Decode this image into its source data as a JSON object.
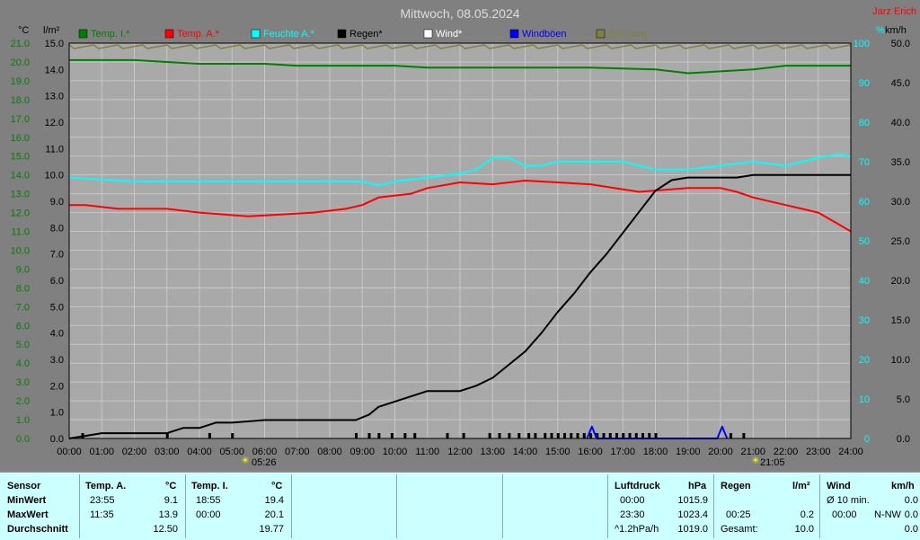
{
  "header": {
    "title": "Mittwoch, 08.05.2024",
    "brand": "Jarz Erich",
    "unit_temp": "°C",
    "unit_rain": "l/m²",
    "unit_pct": "%",
    "unit_wind": "km/h"
  },
  "legend": [
    {
      "label": "Temp. I.*",
      "color": "#008000"
    },
    {
      "label": "Temp. A.*",
      "color": "#ff0000"
    },
    {
      "label": "Feuchte A.*",
      "color": "#00ffff"
    },
    {
      "label": "Regen*",
      "color": "#000000"
    },
    {
      "label": "Wind*",
      "color": "#ffffff"
    },
    {
      "label": "Windböen",
      "color": "#0000ff"
    },
    {
      "label": "Erholung",
      "color": "#808040"
    }
  ],
  "colors": {
    "temp_scale": "#008000",
    "rain_scale": "#000000",
    "humidity_scale": "#00ffff",
    "wind_scale": "#000000",
    "plot_bg": "#a9a9a9",
    "title": "#dcdcdc",
    "brand": "#ff0000"
  },
  "sun": {
    "sunrise": "05:26",
    "sunset": "21:05"
  },
  "chart_data": {
    "type": "line",
    "title": "Mittwoch, 08.05.2024",
    "x_ticks": [
      "00:00",
      "01:00",
      "02:00",
      "03:00",
      "04:00",
      "05:00",
      "06:00",
      "07:00",
      "08:00",
      "09:00",
      "10:00",
      "11:00",
      "12:00",
      "13:00",
      "14:00",
      "15:00",
      "16:00",
      "17:00",
      "18:00",
      "19:00",
      "20:00",
      "21:00",
      "22:00",
      "23:00",
      "24:00"
    ],
    "xlim_hours": [
      0,
      24
    ],
    "axes": {
      "temp": {
        "unit": "°C",
        "range": [
          0,
          21
        ],
        "ticks": [
          "0.0",
          "1.0",
          "2.0",
          "3.0",
          "4.0",
          "5.0",
          "6.0",
          "7.0",
          "8.0",
          "9.0",
          "10.0",
          "11.0",
          "12.0",
          "13.0",
          "14.0",
          "15.0",
          "16.0",
          "17.0",
          "18.0",
          "19.0",
          "20.0",
          "21.0"
        ]
      },
      "rain": {
        "unit": "l/m²",
        "range": [
          0,
          15
        ],
        "ticks": [
          "0.0",
          "1.0",
          "2.0",
          "3.0",
          "4.0",
          "5.0",
          "6.0",
          "7.0",
          "8.0",
          "9.0",
          "10.0",
          "11.0",
          "12.0",
          "13.0",
          "14.0",
          "15.0"
        ]
      },
      "humidity": {
        "unit": "%",
        "range": [
          0,
          100
        ],
        "ticks": [
          "0",
          "10",
          "20",
          "30",
          "40",
          "50",
          "60",
          "70",
          "80",
          "90",
          "100"
        ]
      },
      "wind": {
        "unit": "km/h",
        "range": [
          0,
          50
        ],
        "ticks": [
          "0.0",
          "5.0",
          "10.0",
          "15.0",
          "20.0",
          "25.0",
          "30.0",
          "35.0",
          "40.0",
          "45.0",
          "50.0"
        ]
      }
    },
    "series": [
      {
        "name": "Temp. I.*",
        "axis": "temp",
        "color": "#008000",
        "points": [
          [
            0,
            20.1
          ],
          [
            2,
            20.1
          ],
          [
            3,
            20.0
          ],
          [
            4,
            19.9
          ],
          [
            6,
            19.9
          ],
          [
            7,
            19.8
          ],
          [
            10,
            19.8
          ],
          [
            11,
            19.7
          ],
          [
            16,
            19.7
          ],
          [
            18,
            19.6
          ],
          [
            19,
            19.4
          ],
          [
            20,
            19.5
          ],
          [
            21,
            19.6
          ],
          [
            22,
            19.8
          ],
          [
            24,
            19.8
          ]
        ]
      },
      {
        "name": "Temp. A.*",
        "axis": "temp",
        "color": "#ff0000",
        "points": [
          [
            0,
            12.4
          ],
          [
            0.5,
            12.4
          ],
          [
            1.5,
            12.2
          ],
          [
            3,
            12.2
          ],
          [
            4,
            12.0
          ],
          [
            5.5,
            11.8
          ],
          [
            6.5,
            11.9
          ],
          [
            7.5,
            12.0
          ],
          [
            8.5,
            12.2
          ],
          [
            9,
            12.4
          ],
          [
            9.5,
            12.8
          ],
          [
            10.5,
            13.0
          ],
          [
            11,
            13.3
          ],
          [
            12,
            13.6
          ],
          [
            13,
            13.5
          ],
          [
            14,
            13.7
          ],
          [
            15,
            13.6
          ],
          [
            16,
            13.5
          ],
          [
            17.5,
            13.1
          ],
          [
            19,
            13.3
          ],
          [
            20,
            13.3
          ],
          [
            20.5,
            13.1
          ],
          [
            21,
            12.8
          ],
          [
            22,
            12.4
          ],
          [
            23,
            12.0
          ],
          [
            24,
            11.0
          ]
        ]
      },
      {
        "name": "Feuchte A.*",
        "axis": "humidity",
        "color": "#00ffff",
        "points": [
          [
            0,
            66
          ],
          [
            2,
            65
          ],
          [
            5,
            65
          ],
          [
            9,
            65
          ],
          [
            9.5,
            64
          ],
          [
            10,
            65
          ],
          [
            11,
            66
          ],
          [
            12,
            67
          ],
          [
            12.5,
            68
          ],
          [
            13,
            71
          ],
          [
            13.5,
            71
          ],
          [
            14,
            69
          ],
          [
            14.5,
            69
          ],
          [
            15,
            70
          ],
          [
            16,
            70
          ],
          [
            17,
            70
          ],
          [
            18,
            68
          ],
          [
            19,
            68
          ],
          [
            20,
            69
          ],
          [
            21,
            70
          ],
          [
            22,
            69
          ],
          [
            23,
            71
          ],
          [
            23.7,
            72
          ],
          [
            24,
            71
          ]
        ]
      },
      {
        "name": "Regen*",
        "axis": "rain",
        "color": "#000000",
        "points": [
          [
            0,
            0
          ],
          [
            0.5,
            0.1
          ],
          [
            1,
            0.2
          ],
          [
            2,
            0.2
          ],
          [
            3,
            0.2
          ],
          [
            3.5,
            0.4
          ],
          [
            4,
            0.4
          ],
          [
            4.5,
            0.6
          ],
          [
            5,
            0.6
          ],
          [
            6,
            0.7
          ],
          [
            8,
            0.7
          ],
          [
            8.8,
            0.7
          ],
          [
            9.2,
            0.9
          ],
          [
            9.5,
            1.2
          ],
          [
            10,
            1.4
          ],
          [
            10.5,
            1.6
          ],
          [
            11,
            1.8
          ],
          [
            11.5,
            1.8
          ],
          [
            12,
            1.8
          ],
          [
            12.5,
            2.0
          ],
          [
            13,
            2.3
          ],
          [
            13.5,
            2.8
          ],
          [
            14,
            3.3
          ],
          [
            14.5,
            4.0
          ],
          [
            15,
            4.8
          ],
          [
            15.5,
            5.5
          ],
          [
            16,
            6.3
          ],
          [
            16.5,
            7.0
          ],
          [
            17,
            7.8
          ],
          [
            17.5,
            8.6
          ],
          [
            18,
            9.4
          ],
          [
            18.5,
            9.8
          ],
          [
            19,
            9.9
          ],
          [
            20,
            9.9
          ],
          [
            20.5,
            9.9
          ],
          [
            21,
            10.0
          ],
          [
            24,
            10.0
          ]
        ]
      },
      {
        "name": "Windböen",
        "axis": "wind",
        "color": "#0000ff",
        "points": [
          [
            15.9,
            0
          ],
          [
            16.05,
            1.5
          ],
          [
            16.2,
            0
          ],
          [
            19.9,
            0
          ],
          [
            20.05,
            1.5
          ],
          [
            20.2,
            0
          ]
        ]
      }
    ],
    "rain_bars_hours": [
      0.4,
      3.0,
      4.3,
      5.0,
      8.8,
      9.2,
      9.5,
      9.9,
      10.3,
      10.6,
      11.6,
      12.1,
      12.9,
      13.2,
      13.5,
      13.8,
      14.1,
      14.3,
      14.6,
      14.8,
      15.0,
      15.2,
      15.4,
      15.6,
      15.8,
      16.0,
      16.2,
      16.4,
      16.6,
      16.8,
      17.0,
      17.2,
      17.4,
      17.6,
      17.8,
      18.0,
      20.3,
      20.7
    ]
  },
  "table": {
    "sensor": {
      "header": "Sensor",
      "min": "MinWert",
      "max": "MaxWert",
      "avg": "Durchschnitt"
    },
    "temp_a": {
      "header": "Temp. A.",
      "unit": "°C",
      "min_time": "23:55",
      "min_val": "9.1",
      "max_time": "11:35",
      "max_val": "13.9",
      "avg": "12.50"
    },
    "temp_i": {
      "header": "Temp. I.",
      "unit": "°C",
      "min_time": "18:55",
      "min_val": "19.4",
      "max_time": "00:00",
      "max_val": "20.1",
      "avg": "19.77"
    },
    "pressure": {
      "header": "Luftdruck",
      "unit": "hPa",
      "min_time": "00:00",
      "min_val": "1015.9",
      "max_time": "23:30",
      "max_val": "1023.4",
      "trend_label": "^1.2hPa/h",
      "trend_val": "1019.0"
    },
    "rain": {
      "header": "Regen",
      "unit": "l/m²",
      "max_time": "00:25",
      "max_val": "0.2",
      "total_label": "Gesamt:",
      "total_val": "10.0"
    },
    "wind": {
      "header": "Wind",
      "unit": "km/h",
      "avg10_label": "Ø 10 min.",
      "avg10_val": "0.0",
      "max_time": "00:00",
      "max_dir": "N-NW",
      "max_val": "0.0",
      "avg_val": "0.0"
    }
  }
}
